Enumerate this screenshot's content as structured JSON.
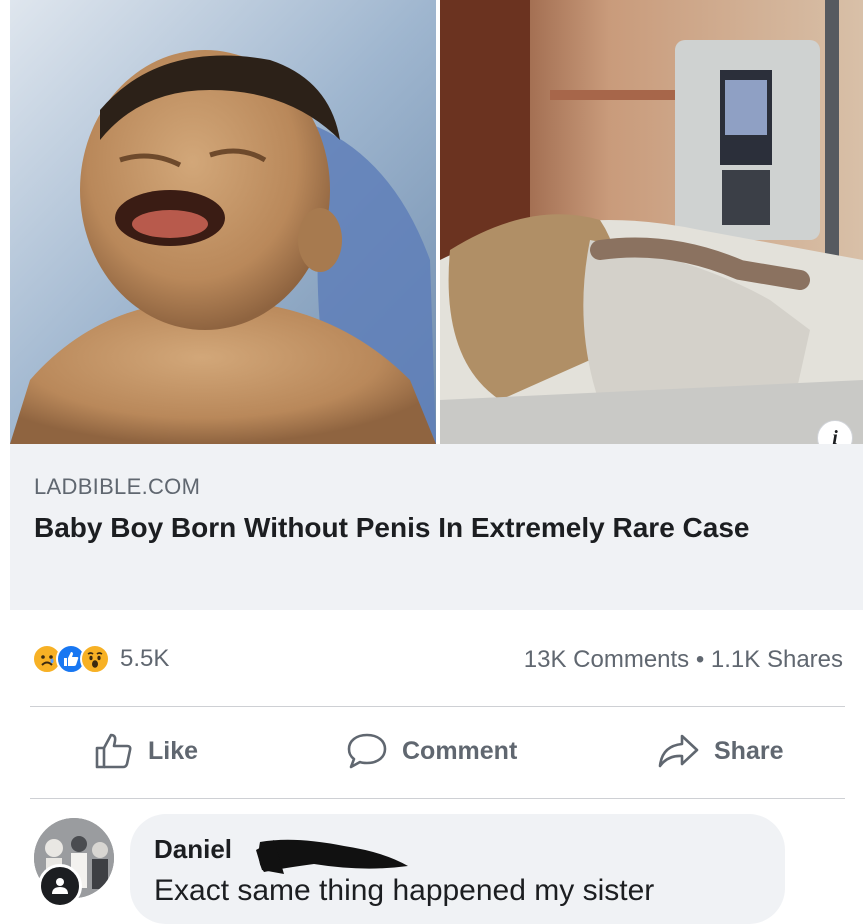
{
  "link_preview": {
    "domain": "LADBIBLE.COM",
    "headline": "Baby Boy Born Without Penis In Extremely Rare Case",
    "info_icon_label": "i"
  },
  "stats": {
    "reaction_icons": [
      "sad-reaction-icon",
      "like-reaction-icon",
      "wow-reaction-icon"
    ],
    "reaction_count": "5.5K",
    "comments_shares": "13K Comments • 1.1K Shares"
  },
  "actions": {
    "like_label": "Like",
    "comment_label": "Comment",
    "share_label": "Share"
  },
  "comment": {
    "author": "Daniel",
    "text": "Exact same thing happened my sister"
  },
  "colors": {
    "card_background": "#f0f2f5",
    "secondary_text": "#606770",
    "like_blue": "#1877f2",
    "reaction_yellow": "#f7b125"
  }
}
